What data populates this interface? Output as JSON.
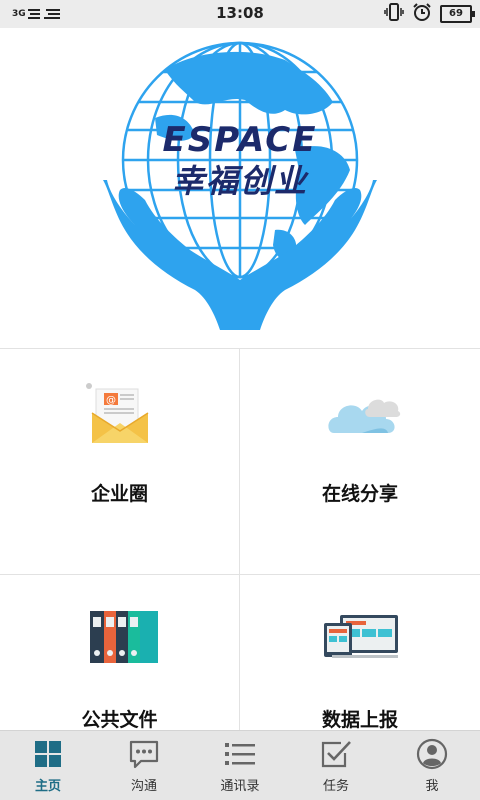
{
  "status_bar": {
    "network": "3G",
    "time": "13:08",
    "battery": "69"
  },
  "logo": {
    "brand_en": "ESPACE",
    "brand_cn": "幸福创业"
  },
  "tiles": [
    {
      "label": "企业圈",
      "icon": "mail-envelope-icon"
    },
    {
      "label": "在线分享",
      "icon": "cloud-icon"
    },
    {
      "label": "公共文件",
      "icon": "binders-icon"
    },
    {
      "label": "数据上报",
      "icon": "devices-icon"
    }
  ],
  "bottom_nav": [
    {
      "label": "主页",
      "icon": "home-grid-icon",
      "active": true
    },
    {
      "label": "沟通",
      "icon": "chat-icon",
      "active": false
    },
    {
      "label": "通讯录",
      "icon": "list-icon",
      "active": false
    },
    {
      "label": "任务",
      "icon": "checkbox-icon",
      "active": false
    },
    {
      "label": "我",
      "icon": "profile-icon",
      "active": false
    }
  ],
  "colors": {
    "accent": "#1f6d86",
    "globe_blue": "#2ea3ee",
    "logo_navy": "#1c2a6b"
  }
}
